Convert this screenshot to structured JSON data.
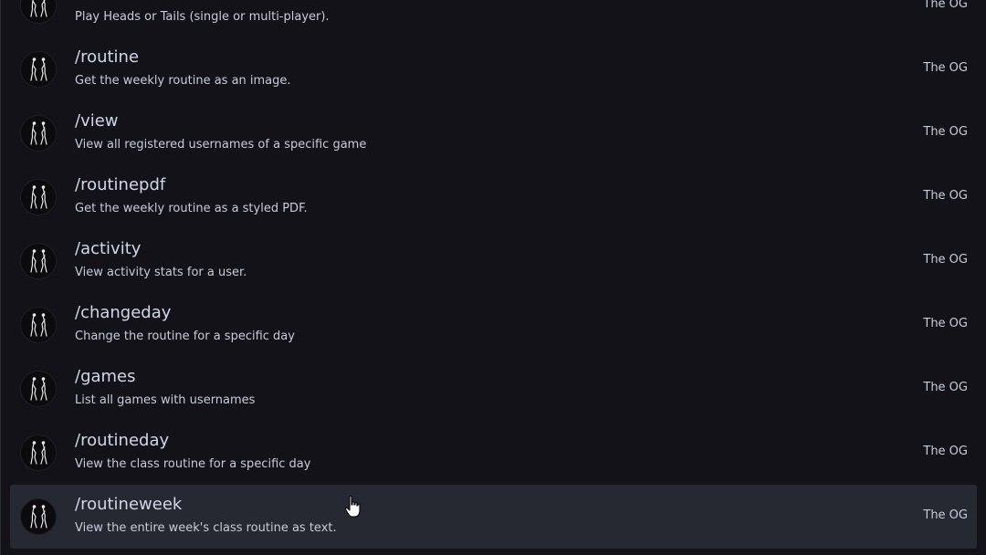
{
  "commands": [
    {
      "name": "",
      "description": "Play Heads or Tails (single or multi-player).",
      "source": "The OG"
    },
    {
      "name": "/routine",
      "description": "Get the weekly routine as an image.",
      "source": "The OG"
    },
    {
      "name": "/view",
      "description": "View all registered usernames of a specific game",
      "source": "The OG"
    },
    {
      "name": "/routinepdf",
      "description": "Get the weekly routine as a styled PDF.",
      "source": "The OG"
    },
    {
      "name": "/activity",
      "description": "View activity stats for a user.",
      "source": "The OG"
    },
    {
      "name": "/changeday",
      "description": "Change the routine for a specific day",
      "source": "The OG"
    },
    {
      "name": "/games",
      "description": "List all games with usernames",
      "source": "The OG"
    },
    {
      "name": "/routineday",
      "description": "View the class routine for a specific day",
      "source": "The OG"
    },
    {
      "name": "/routineweek",
      "description": "View the entire week's class routine as text.",
      "source": "The OG"
    }
  ],
  "hovered_index": 8,
  "avatar_icon": "bot-avatar-icon",
  "cursor_icon": "hand-pointer-icon",
  "colors": {
    "background": "#121218",
    "hover_row": "#262832",
    "text": "#d2d7e6"
  }
}
